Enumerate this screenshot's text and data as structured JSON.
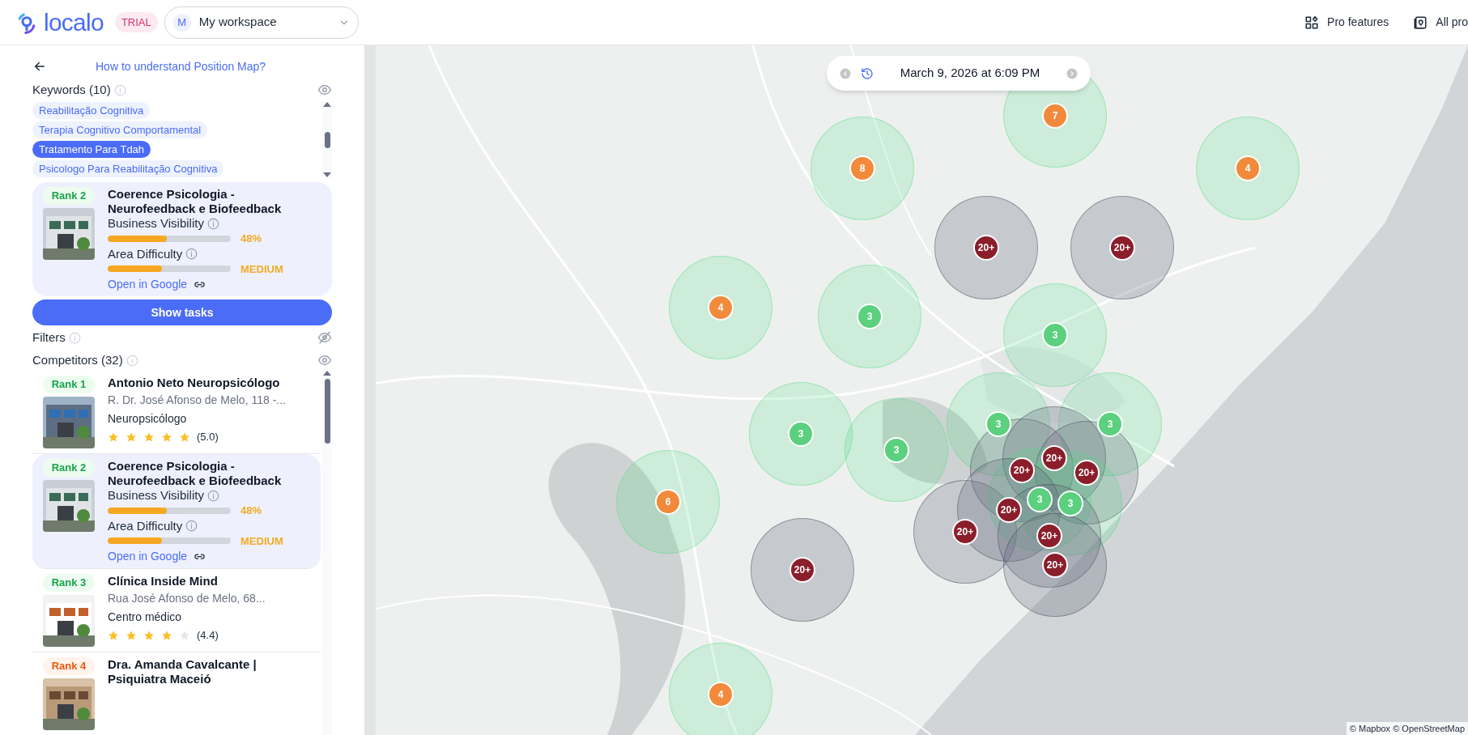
{
  "header": {
    "logo": "localo",
    "badge": "TRIAL",
    "workspace": {
      "avatar": "M",
      "name": "My workspace"
    },
    "actions": [
      {
        "label": "Pro features"
      },
      {
        "label": "All pro"
      }
    ]
  },
  "sidebar": {
    "help_link": "How to understand Position Map?",
    "keywords": {
      "title": "Keywords (10)",
      "visible": true,
      "items": [
        {
          "label": "Reabilitação Cognitiva",
          "selected": false
        },
        {
          "label": "Terapia Cognitivo Comportamental",
          "selected": false
        },
        {
          "label": "Tratamento Para Tdah",
          "selected": true
        },
        {
          "label": "Psicologo Para Reabilitação Cognitiva",
          "selected": false
        }
      ]
    },
    "business": {
      "rank": "Rank 2",
      "name": "Coerence Psicologia - Neurofeedback e Biofeedback",
      "visibility_label": "Business Visibility",
      "visibility": {
        "level": 0.48,
        "reading": "48%"
      },
      "difficulty_label": "Area Difficulty",
      "difficulty": {
        "level": 0.44,
        "reading": "MEDIUM"
      },
      "link": "Open in Google"
    },
    "show_tasks": "Show tasks",
    "filters": {
      "title": "Filters",
      "visible": false
    },
    "competitors": {
      "title": "Competitors (32)",
      "visible": true,
      "items": [
        {
          "kind": "basic",
          "rank": "Rank 1",
          "color": "#16a34a",
          "selected": false,
          "name": "Antonio Neto Neuropsicólogo",
          "address": "R. Dr. José Afonso de Melo, 118 -...",
          "category": "Neuropsicólogo",
          "stars": 5,
          "rating": "(5.0)"
        },
        {
          "kind": "detailed",
          "rank": "Rank 2",
          "color": "#16a34a",
          "selected": true,
          "name": "Coerence Psicologia - Neurofeedback e Biofeedback",
          "visibility_label": "Business Visibility",
          "visibility": {
            "level": 0.48,
            "reading": "48%"
          },
          "difficulty_label": "Area Difficulty",
          "difficulty": {
            "level": 0.44,
            "reading": "MEDIUM"
          },
          "link": "Open in Google"
        },
        {
          "kind": "basic",
          "rank": "Rank 3",
          "color": "#16a34a",
          "selected": false,
          "name": "Clínica Inside Mind",
          "address": "Rua José Afonso de Melo, 68...",
          "category": "Centro médico",
          "stars": 4,
          "rating": "(4.4)"
        },
        {
          "kind": "basic",
          "rank": "Rank 4",
          "color": "#ea580c",
          "selected": false,
          "name": "Dra. Amanda Cavalcante | Psiquiatra Maceió"
        }
      ]
    }
  },
  "map": {
    "date": "March 9, 2026 at 6:09 PM",
    "attribution": "© Mapbox © OpenStreetMap",
    "markers": [
      {
        "label": "7",
        "kind": "mid"
      },
      {
        "label": "8",
        "kind": "mid"
      },
      {
        "label": "4",
        "kind": "mid"
      },
      {
        "label": "20+",
        "kind": "poor"
      },
      {
        "label": "20+",
        "kind": "poor"
      },
      {
        "label": "4",
        "kind": "mid"
      },
      {
        "label": "3",
        "kind": "good"
      },
      {
        "label": "3",
        "kind": "good"
      },
      {
        "label": "3",
        "kind": "good"
      },
      {
        "label": "3",
        "kind": "good"
      },
      {
        "label": "3",
        "kind": "good"
      },
      {
        "label": "3",
        "kind": "good"
      },
      {
        "label": "6",
        "kind": "mid"
      },
      {
        "label": "20+",
        "kind": "poor"
      },
      {
        "label": "20+",
        "kind": "poor"
      },
      {
        "label": "4",
        "kind": "mid"
      },
      {
        "label": "20+",
        "kind": "poor"
      },
      {
        "label": "20+",
        "kind": "poor"
      },
      {
        "label": "20+",
        "kind": "poor"
      },
      {
        "label": "3",
        "kind": "good"
      },
      {
        "label": "3",
        "kind": "good"
      },
      {
        "label": "20+",
        "kind": "poor"
      },
      {
        "label": "20+",
        "kind": "poor"
      },
      {
        "label": "20+",
        "kind": "poor"
      }
    ]
  }
}
